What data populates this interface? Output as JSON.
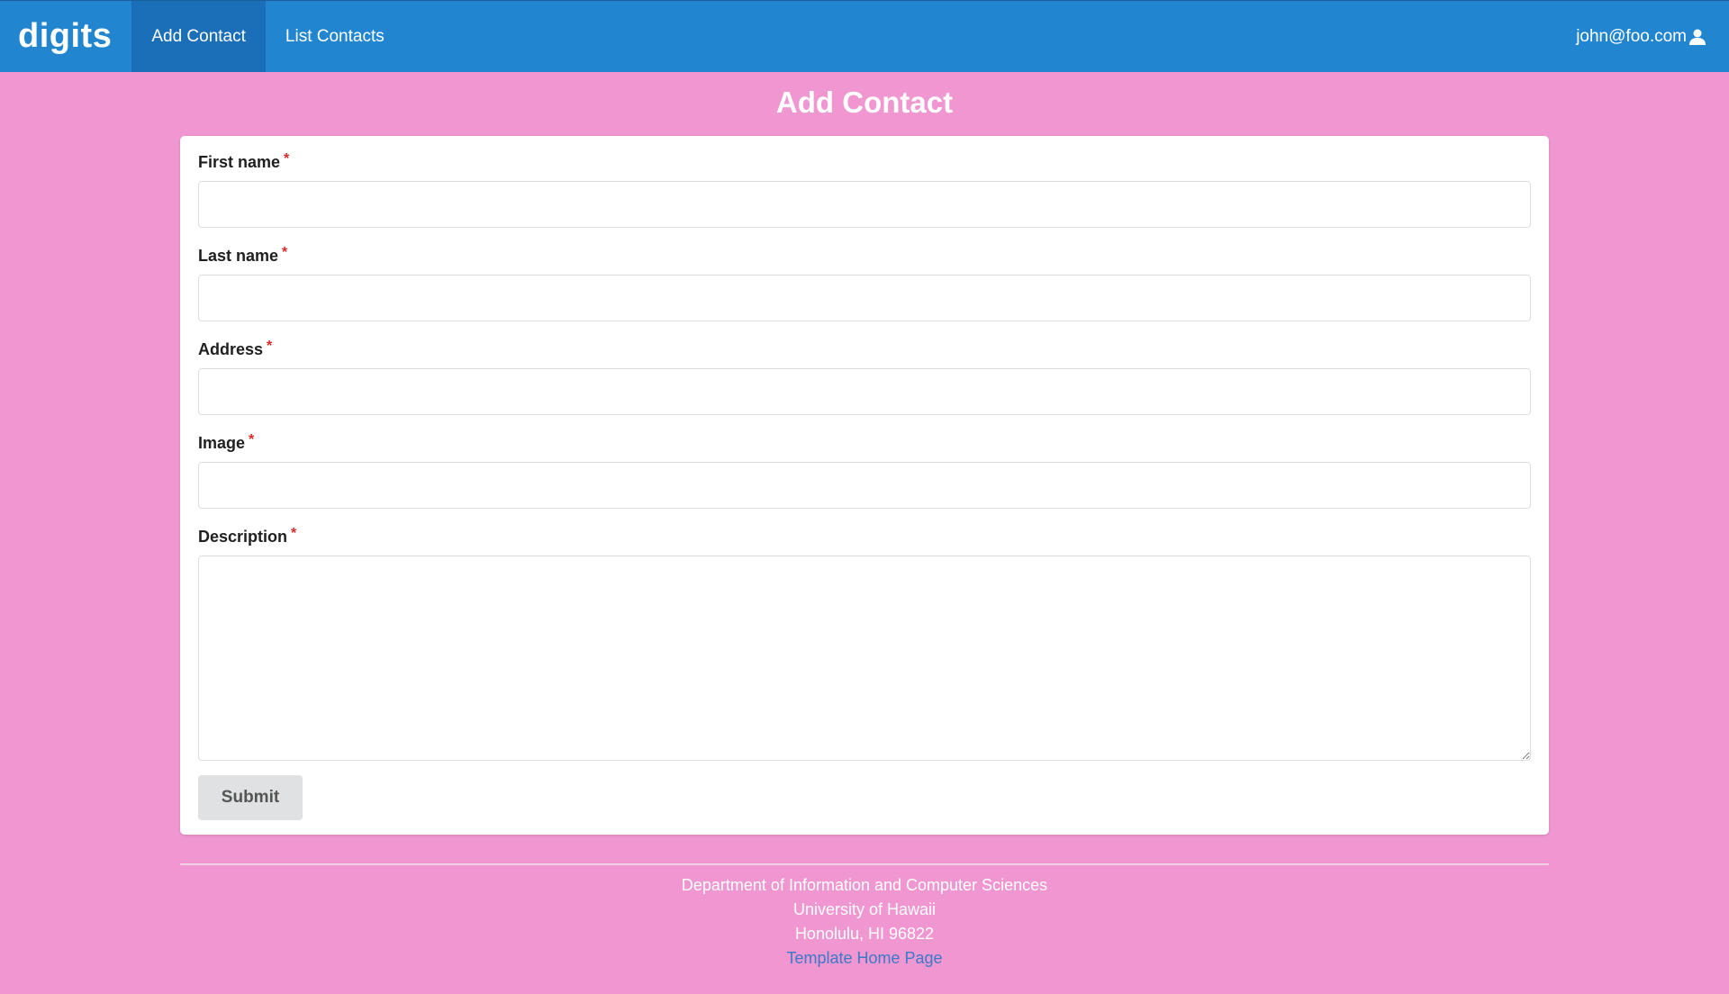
{
  "nav": {
    "brand": "digits",
    "items": [
      {
        "label": "Add Contact",
        "active": true
      },
      {
        "label": "List Contacts",
        "active": false
      }
    ],
    "user_email": "john@foo.com",
    "user_icon": "user-icon"
  },
  "page": {
    "title": "Add Contact"
  },
  "form": {
    "fields": [
      {
        "label": "First name",
        "value": "",
        "required": true
      },
      {
        "label": "Last name",
        "value": "",
        "required": true
      },
      {
        "label": "Address",
        "value": "",
        "required": true
      },
      {
        "label": "Image",
        "value": "",
        "required": true
      },
      {
        "label": "Description",
        "value": "",
        "required": true
      }
    ],
    "required_marker": "*",
    "submit_label": "Submit"
  },
  "footer": {
    "line1": "Department of Information and Computer Sciences",
    "line2": "University of Hawaii",
    "line3": "Honolulu, HI 96822",
    "link_label": "Template Home Page"
  },
  "colors": {
    "navbar": "#2185d0",
    "background": "#f096d0",
    "required": "#db2828",
    "link": "#3b79c9"
  }
}
